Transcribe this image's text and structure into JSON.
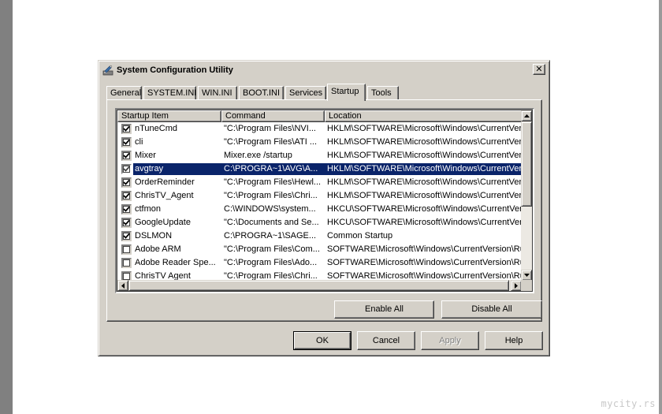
{
  "window": {
    "title": "System Configuration Utility",
    "close_glyph": "✕"
  },
  "tabs": [
    {
      "label": "General",
      "active": false
    },
    {
      "label": "SYSTEM.INI",
      "active": false
    },
    {
      "label": "WIN.INI",
      "active": false
    },
    {
      "label": "BOOT.INI",
      "active": false
    },
    {
      "label": "Services",
      "active": false
    },
    {
      "label": "Startup",
      "active": true
    },
    {
      "label": "Tools",
      "active": false
    }
  ],
  "startup_list": {
    "columns": [
      "Startup Item",
      "Command",
      "Location"
    ],
    "rows": [
      {
        "item": "nTuneCmd",
        "command": "\"C:\\Program Files\\NVI...",
        "location": "HKLM\\SOFTWARE\\Microsoft\\Windows\\CurrentVer...",
        "checked": true,
        "selected": false
      },
      {
        "item": "cli",
        "command": "\"C:\\Program Files\\ATI ...",
        "location": "HKLM\\SOFTWARE\\Microsoft\\Windows\\CurrentVer...",
        "checked": true,
        "selected": false
      },
      {
        "item": "Mixer",
        "command": "Mixer.exe /startup",
        "location": "HKLM\\SOFTWARE\\Microsoft\\Windows\\CurrentVer...",
        "checked": true,
        "selected": false
      },
      {
        "item": "avgtray",
        "command": "C:\\PROGRA~1\\AVG\\A...",
        "location": "HKLM\\SOFTWARE\\Microsoft\\Windows\\CurrentVer...",
        "checked": true,
        "selected": true
      },
      {
        "item": "OrderReminder",
        "command": "\"C:\\Program Files\\Hewl...",
        "location": "HKLM\\SOFTWARE\\Microsoft\\Windows\\CurrentVer...",
        "checked": true,
        "selected": false
      },
      {
        "item": "ChrisTV_Agent",
        "command": "\"C:\\Program Files\\Chri...",
        "location": "HKLM\\SOFTWARE\\Microsoft\\Windows\\CurrentVer...",
        "checked": true,
        "selected": false
      },
      {
        "item": "ctfmon",
        "command": "C:\\WINDOWS\\system...",
        "location": "HKCU\\SOFTWARE\\Microsoft\\Windows\\CurrentVer...",
        "checked": true,
        "selected": false
      },
      {
        "item": "GoogleUpdate",
        "command": "\"C:\\Documents and Se...",
        "location": "HKCU\\SOFTWARE\\Microsoft\\Windows\\CurrentVer...",
        "checked": true,
        "selected": false
      },
      {
        "item": "DSLMON",
        "command": "C:\\PROGRA~1\\SAGE...",
        "location": "Common Startup",
        "checked": true,
        "selected": false
      },
      {
        "item": "Adobe ARM",
        "command": "\"C:\\Program Files\\Com...",
        "location": "SOFTWARE\\Microsoft\\Windows\\CurrentVersion\\Ru...",
        "checked": false,
        "selected": false
      },
      {
        "item": "Adobe Reader Spe...",
        "command": "\"C:\\Program Files\\Ado...",
        "location": "SOFTWARE\\Microsoft\\Windows\\CurrentVersion\\Ru...",
        "checked": false,
        "selected": false
      },
      {
        "item": "ChrisTV Agent",
        "command": "\"C:\\Program Files\\Chri...",
        "location": "SOFTWARE\\Microsoft\\Windows\\CurrentVersion\\Ru...",
        "checked": false,
        "selected": false
      }
    ]
  },
  "panel_buttons": {
    "enable_all": "Enable All",
    "disable_all": "Disable All"
  },
  "dialog_buttons": {
    "ok": "OK",
    "cancel": "Cancel",
    "apply": "Apply",
    "help": "Help"
  },
  "watermark": "mycity.rs",
  "colors": {
    "selection": "#0a246a",
    "face": "#d4d0c8"
  }
}
